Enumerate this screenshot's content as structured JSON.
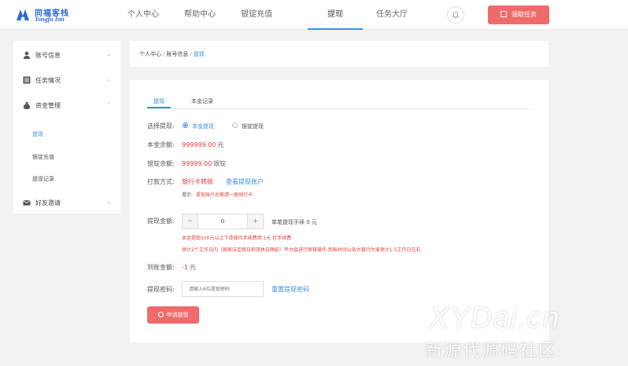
{
  "brand": {
    "name_cn": "同福客栈",
    "name_en": "Tongfu Inn",
    "primary": "#3a8ee6",
    "accent": "#ef6b6b"
  },
  "nav": {
    "items": [
      "个人中心",
      "帮助中心",
      "银锭充值",
      "提现",
      "任务大厅"
    ],
    "active": "提现",
    "bell_icon": "bell-icon",
    "cta_label": "領取任务"
  },
  "sidebar": {
    "groups": [
      {
        "label": "账号信息",
        "icon": "user-icon"
      },
      {
        "label": "任务情况",
        "icon": "list-icon"
      },
      {
        "label": "资金管理",
        "icon": "money-icon"
      },
      {
        "label": "好友邀请",
        "icon": "mail-icon"
      }
    ],
    "finance_items": [
      "提现",
      "银锭充值",
      "提现记录"
    ],
    "active_item": "提现"
  },
  "breadcrumb": {
    "items": [
      "个人中心",
      "账号信息"
    ],
    "current": "提现",
    "separator": "/"
  },
  "tabs": {
    "items": [
      "提现",
      "本金记录"
    ],
    "active": "提现"
  },
  "form": {
    "select_label": "选择提现:",
    "options": [
      "本金提现",
      "银锭提现"
    ],
    "selected_option": "本金提现",
    "principal_label": "本金余额:",
    "principal_value": "999999.00",
    "principal_unit": "元",
    "silver_label": "银锭余额:",
    "silver_value": "99999.00",
    "silver_unit": "银锭",
    "payout_label": "打款方式:",
    "payout_method": "银行卡转账",
    "view_account_link": "查看提现账户",
    "payout_tip_key": "提示:",
    "payout_tip": "提现账户后期请一致绑行卡",
    "amount_label": "提现金额:",
    "amount_value": "0",
    "fee_text": "单笔提现手续 0 元",
    "fee_note": "本金提现500元以上下单操作手续费用 1元 打手续费",
    "time_note": "预计2个工作日内（国家法定假日和双休日顺延）平台会进行审核操作 到账时间以各大银行为准预计1-5工作日左右",
    "received_label": "到账金额:",
    "received_value": "-1",
    "received_unit": "元",
    "password_label": "提现密码:",
    "password_placeholder": "请输入6位提现密码",
    "reset_password_link": "重置提现密码",
    "submit_label": "申请提现"
  },
  "watermark": {
    "text_en": "XYDai.cn",
    "text_cn": "新源代源码社区"
  }
}
